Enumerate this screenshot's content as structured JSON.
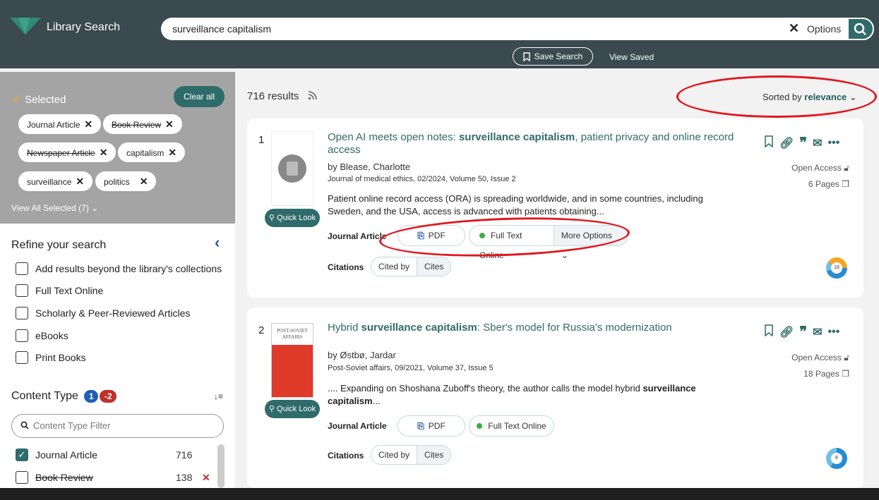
{
  "header": {
    "brand": "Library Search",
    "query": "surveillance capitalism",
    "options_label": "Options",
    "save_search_label": "Save Search",
    "view_saved_label": "View Saved"
  },
  "selected": {
    "title": "Selected",
    "clear_all": "Clear all",
    "chips": [
      "Journal Article",
      "Book Review",
      "Newspaper Article",
      "capitalism",
      "surveillance",
      "politics"
    ],
    "view_all": "View All Selected (7) ⌄"
  },
  "refine": {
    "title": "Refine your search",
    "checkboxes": [
      "Add results beyond the library's collections",
      "Full Text Online",
      "Scholarly & Peer-Reviewed Articles",
      "eBooks",
      "Print Books"
    ]
  },
  "content_type": {
    "title": "Content Type",
    "badge_include": "1",
    "badge_exclude": "-2",
    "filter_placeholder": "Content Type Filter",
    "items": [
      {
        "label": "Journal Article",
        "count": "716"
      },
      {
        "label": "Book Review",
        "count": "138"
      }
    ]
  },
  "results": {
    "count": "716 results",
    "sorted_prefix": "Sorted by",
    "sorted_value": "relevance"
  },
  "records": [
    {
      "num": "1",
      "title_pre": "Open AI meets open notes: ",
      "title_bold": "surveillance capitalism",
      "title_post": ", patient privacy and online record access",
      "author": "by Blease, Charlotte",
      "journal": "Journal of medical ethics, 02/2024, Volume 50, Issue 2",
      "snippet_pre": "Patient online record access (ORA) is spreading worldwide, and in some countries, including Sweden, and the USA, access is advanced with patients obtaining...",
      "snippet_bold": "",
      "snippet_post": "",
      "type": "Journal Article",
      "pdf": "PDF",
      "full_text": "Full Text Online",
      "more_options": "More Options ⌄",
      "citations": "Citations",
      "cited_by": "Cited by",
      "cites": "Cites",
      "open_access": "Open Access",
      "pages": "6 Pages",
      "quick_look": "Quick Look",
      "altmetric": "18"
    },
    {
      "num": "2",
      "title_pre": "Hybrid ",
      "title_bold": "surveillance capitalism",
      "title_post": ": Sber's model for Russia's modernization",
      "author": "by Østbø, Jardar",
      "journal": "Post-Soviet affairs, 09/2021, Volume 37, Issue 5",
      "snippet_pre": ".... Expanding on Shoshana Zuboff's theory, the author calls the model hybrid ",
      "snippet_bold": "surveillance capitalism",
      "snippet_post": "...",
      "type": "Journal Article",
      "pdf": "PDF",
      "full_text": "Full Text Online",
      "more_options": "",
      "citations": "Citations",
      "cited_by": "Cited by",
      "cites": "Cites",
      "open_access": "Open Access",
      "pages": "18 Pages",
      "quick_look": "Quick Look",
      "altmetric": "8",
      "cover_text": "POST-SOVIET AFFAIRS"
    }
  ],
  "colors": {
    "header_bg": "#3a4a4e",
    "accent": "#2f6b6a",
    "annotation": "#e0171d"
  }
}
